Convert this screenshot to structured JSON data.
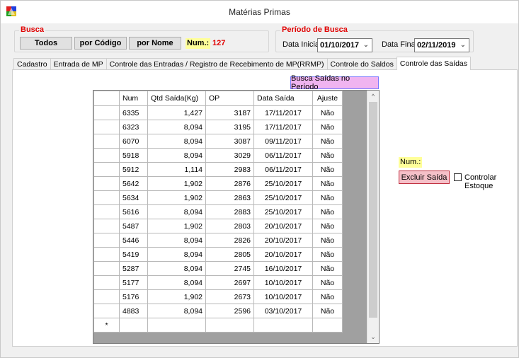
{
  "window": {
    "title": "Matérias Primas"
  },
  "busca": {
    "label": "Busca",
    "btn_todos": "Todos",
    "btn_codigo": "por Código",
    "btn_nome": "por Nome",
    "num_label": "Num.:",
    "num_value": "127"
  },
  "periodo": {
    "label": "Período de Busca",
    "inicial_label": "Data Inicial",
    "inicial_value": "01/10/2017",
    "final_label": "Data Final",
    "final_value": "02/11/2019"
  },
  "tabs": [
    {
      "label": "Cadastro"
    },
    {
      "label": "Entrada de MP"
    },
    {
      "label": "Controle das Entradas / Registro de Recebimento de MP(RRMP)"
    },
    {
      "label": "Controle do Saldos"
    },
    {
      "label": "Controle das Saídas"
    }
  ],
  "panel": {
    "busca_saidas_btn": "Busca Saídas no Período",
    "num_label": "Num.:",
    "excluir_btn": "Excluir Saída",
    "controlar_estoque": "Controlar Estoque"
  },
  "grid": {
    "columns": [
      "Num",
      "Qtd Saída(Kg)",
      "OP",
      "Data Saída",
      "Ajuste"
    ],
    "rows": [
      [
        "6335",
        "1,427",
        "3187",
        "17/11/2017",
        "Não"
      ],
      [
        "6323",
        "8,094",
        "3195",
        "17/11/2017",
        "Não"
      ],
      [
        "6070",
        "8,094",
        "3087",
        "09/11/2017",
        "Não"
      ],
      [
        "5918",
        "8,094",
        "3029",
        "06/11/2017",
        "Não"
      ],
      [
        "5912",
        "1,114",
        "2983",
        "06/11/2017",
        "Não"
      ],
      [
        "5642",
        "1,902",
        "2876",
        "25/10/2017",
        "Não"
      ],
      [
        "5634",
        "1,902",
        "2863",
        "25/10/2017",
        "Não"
      ],
      [
        "5616",
        "8,094",
        "2883",
        "25/10/2017",
        "Não"
      ],
      [
        "5487",
        "1,902",
        "2803",
        "20/10/2017",
        "Não"
      ],
      [
        "5446",
        "8,094",
        "2826",
        "20/10/2017",
        "Não"
      ],
      [
        "5419",
        "8,094",
        "2805",
        "20/10/2017",
        "Não"
      ],
      [
        "5287",
        "8,094",
        "2745",
        "16/10/2017",
        "Não"
      ],
      [
        "5177",
        "8,094",
        "2697",
        "10/10/2017",
        "Não"
      ],
      [
        "5176",
        "1,902",
        "2673",
        "10/10/2017",
        "Não"
      ],
      [
        "4883",
        "8,094",
        "2596",
        "03/10/2017",
        "Não"
      ]
    ],
    "new_row_marker": "*"
  }
}
